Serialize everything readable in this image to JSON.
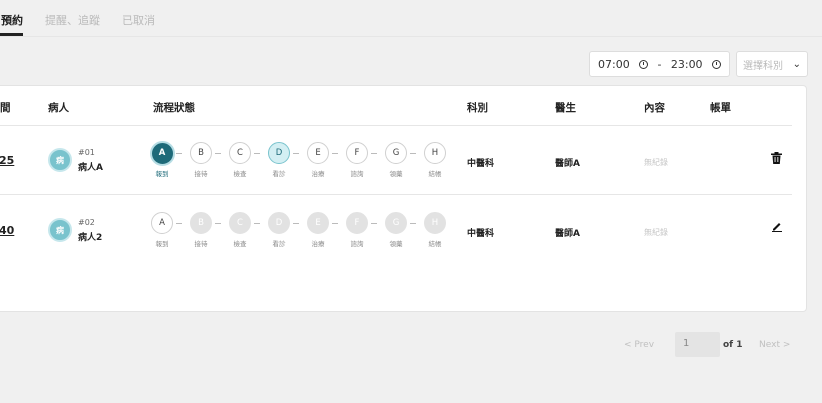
{
  "tabs": [
    {
      "label": "日預約",
      "active": true
    },
    {
      "label": "提醒、追蹤",
      "active": false
    },
    {
      "label": "已取消",
      "active": false
    }
  ],
  "filters": {
    "time_start": "07:00",
    "time_sep": "-",
    "time_end": "23:00",
    "dept_placeholder": "選擇科別",
    "dept_chevron": "⌄"
  },
  "table": {
    "headers": {
      "time": "間",
      "patient": "病人",
      "flow": "流程狀態",
      "dept": "科別",
      "doctor": "醫生",
      "content": "內容",
      "bill": "帳單"
    },
    "rows": [
      {
        "time": "25",
        "avatar_text": "病",
        "number": "#01",
        "name": "病人A",
        "dept": "中醫科",
        "doctor": "醫師A",
        "content": "無紀錄",
        "action_icon": "trash-icon",
        "steps": [
          {
            "letter": "A",
            "label": "報到",
            "state": "done"
          },
          {
            "letter": "B",
            "label": "接待",
            "state": "todo"
          },
          {
            "letter": "C",
            "label": "檢查",
            "state": "todo"
          },
          {
            "letter": "D",
            "label": "看診",
            "state": "current"
          },
          {
            "letter": "E",
            "label": "治療",
            "state": "todo"
          },
          {
            "letter": "F",
            "label": "諮詢",
            "state": "todo"
          },
          {
            "letter": "G",
            "label": "領藥",
            "state": "todo"
          },
          {
            "letter": "H",
            "label": "結帳",
            "state": "todo"
          }
        ]
      },
      {
        "time": "40",
        "avatar_text": "病",
        "number": "#02",
        "name": "病人2",
        "dept": "中醫科",
        "doctor": "醫師A",
        "content": "無紀錄",
        "action_icon": "edit-icon",
        "steps": [
          {
            "letter": "A",
            "label": "報到",
            "state": "todo"
          },
          {
            "letter": "B",
            "label": "接待",
            "state": "dim"
          },
          {
            "letter": "C",
            "label": "檢查",
            "state": "dim"
          },
          {
            "letter": "D",
            "label": "看診",
            "state": "dim"
          },
          {
            "letter": "E",
            "label": "治療",
            "state": "dim"
          },
          {
            "letter": "F",
            "label": "諮詢",
            "state": "dim"
          },
          {
            "letter": "G",
            "label": "領藥",
            "state": "dim"
          },
          {
            "letter": "H",
            "label": "結帳",
            "state": "dim"
          }
        ]
      }
    ]
  },
  "pagination": {
    "prev_label": "< Prev",
    "page": "1",
    "of_label": "of 1",
    "next_label": "Next >"
  },
  "colors": {
    "accent": "#1e6a79",
    "accent_light": "#79c3cd"
  }
}
